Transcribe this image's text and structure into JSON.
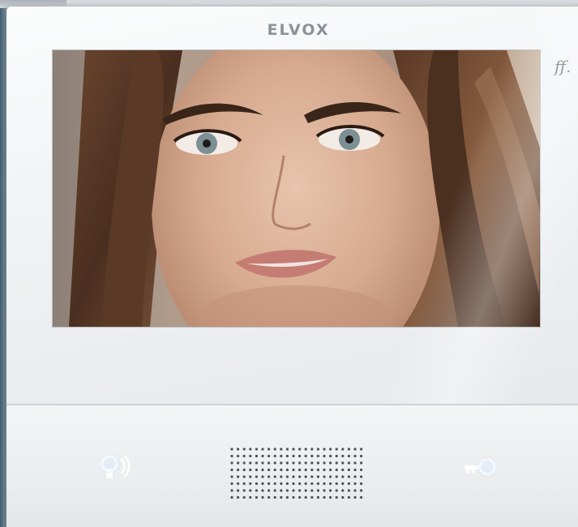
{
  "device": {
    "brand": "ELVOX",
    "status_glyph": "ﬀ.",
    "video_feed": "visitor-camera"
  },
  "controls": {
    "answer_button": "answer-call",
    "door_button": "door-release"
  },
  "icons": [
    "phone-audio-icon",
    "key-icon",
    "speaker-grille"
  ],
  "colors": {
    "device_body": "#eceef0",
    "brand_text": "#8d9298",
    "screen_frame": "#b7bcc1"
  }
}
